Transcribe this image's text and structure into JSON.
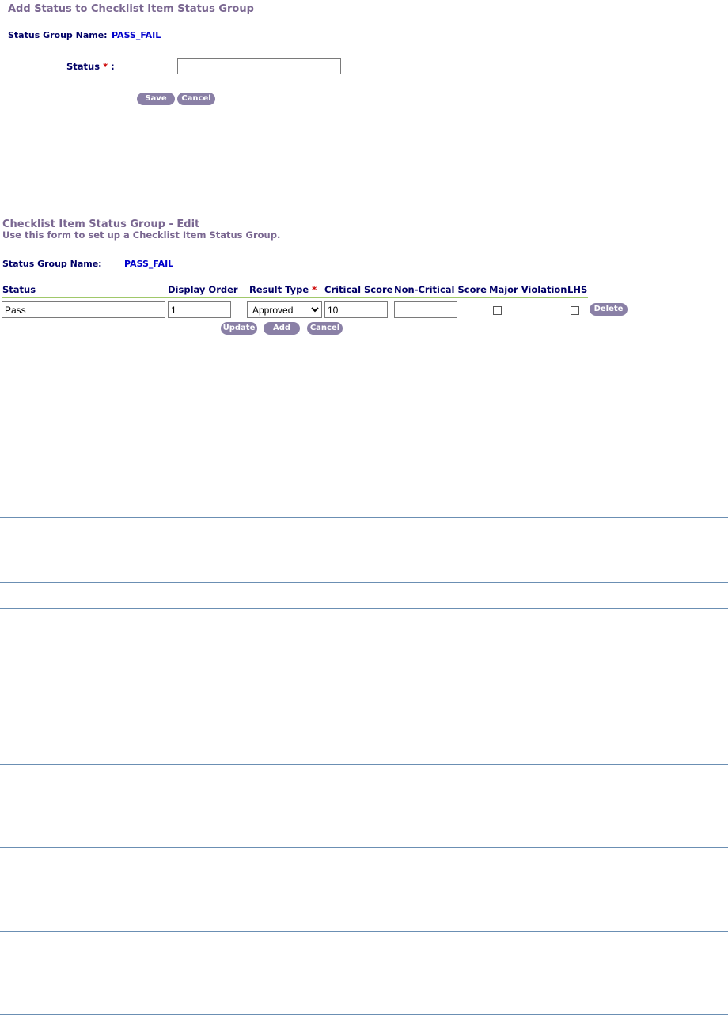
{
  "add_section": {
    "title": "Add Status to Checklist Item Status Group",
    "group_name_label": "Status Group Name:",
    "group_name_value": "PASS_FAIL",
    "status_label": "Status",
    "required_mark": "*",
    "colon": ":",
    "status_value": "",
    "save_label": "Save",
    "cancel_label": "Cancel"
  },
  "edit_section": {
    "title": "Checklist Item Status Group - Edit",
    "subtitle": "Use this form to set up a Checklist Item Status Group.",
    "group_name_label": "Status Group Name:",
    "group_name_value": "PASS_FAIL",
    "columns": {
      "status": "Status",
      "display_order": "Display Order",
      "result_type": "Result Type",
      "result_type_required": "*",
      "critical_score": "Critical Score",
      "non_critical_score": "Non-Critical Score",
      "major_violation": "Major Violation",
      "lhs": "LHS"
    },
    "row": {
      "status": "Pass",
      "display_order": "1",
      "result_type": "Approved",
      "critical_score": "10",
      "non_critical_score": "",
      "major_violation": false,
      "lhs": false,
      "delete_label": "Delete"
    },
    "update_label": "Update",
    "add_label": "Add",
    "cancel_label": "Cancel"
  },
  "colors": {
    "title_purple": "#7a6791",
    "label_navy": "#000066",
    "value_blue": "#0000cc",
    "required_red": "#cc0000",
    "button_bg": "#8a80a6",
    "header_rule_green": "#a0c86a",
    "divider_blue": "#6b8fb3"
  }
}
